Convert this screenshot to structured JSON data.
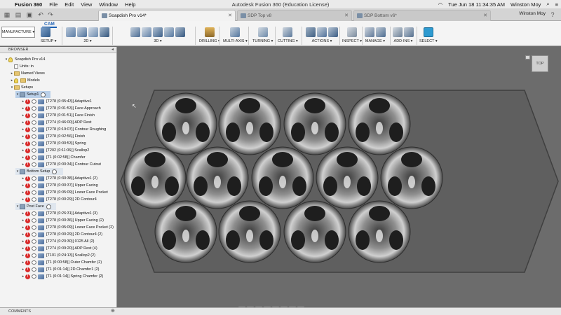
{
  "menubar": {
    "app_name": "Fusion 360",
    "menus": [
      "File",
      "Edit",
      "View",
      "Window",
      "Help"
    ],
    "window_title": "Autodesk Fusion 360 (Education License)",
    "datetime": "Tue Jun 18  11:34:35 AM",
    "user": "Winston Moy"
  },
  "tabs": [
    {
      "label": "Soapdish Pro v14*",
      "state": "active"
    },
    {
      "label": "SDP Top v8",
      "state": "inactive"
    },
    {
      "label": "SDP Bottom v6*",
      "state": "inactive"
    }
  ],
  "tabstrip_user": "Winston Moy",
  "toolbar": {
    "workspace": "MANUFACTURE",
    "cam_tab": "CAM",
    "groups": [
      {
        "label": "SETUP ▾"
      },
      {
        "label": "2D ▾"
      },
      {
        "label": "3D ▾"
      },
      {
        "label": "DRILLING ▾"
      },
      {
        "label": "MULTI-AXIS ▾"
      },
      {
        "label": "TURNING ▾"
      },
      {
        "label": "CUTTING ▾"
      },
      {
        "label": "ACTIONS ▾"
      },
      {
        "label": "INSPECT ▾"
      },
      {
        "label": "MANAGE ▾"
      },
      {
        "label": "ADD-INS ▾"
      },
      {
        "label": "SELECT ▾"
      }
    ]
  },
  "browser": {
    "header": "BROWSER",
    "root": "Soapdish Pro v14",
    "units": "Units: in",
    "named_views": "Named Views",
    "models": "Models",
    "setups": "Setups",
    "setup1": {
      "label": "Setup1",
      "ops": [
        "[T278 (0:35:43)] Adaptive1",
        "[T278 (0:01:53)] Face Approach",
        "[T278 (0:01:51)] Face Finish",
        "[T274 (0:46:00)] ADP Rest",
        "[T278 (0:19:07)] Contour Roughing",
        "[T278 (0:02:56)] Finish",
        "[T278 (0:00:53)] Spring",
        "[T202 (0:11:06)] Scallop2",
        "[T1 (0:02:58)] Chamfer",
        "[T278 (0:00:34)] Contour Cutout"
      ]
    },
    "bottom_setup": {
      "label": "Bottom Setup",
      "ops": [
        "[T278 (0:30:38)] Adaptive1 (2)",
        "[T278 (0:00:37)] Upper Facing",
        "[T278 (0:05:09)] Lower Face Pocket",
        "[T278 (0:00:29)] 2D Contour4"
      ]
    },
    "post_face": {
      "label": "Post Face",
      "ops": [
        "[T278 (0:26:31)] Adaptive1 (3)",
        "[T278 (0:00:36)] Upper Facing (2)",
        "[T278 (0:05:09)] Lower Face Pocket (2)",
        "[T278 (0:00:29)] 2D Contour4 (2)",
        "[T274 (0:20:30)] 0125 All (2)",
        "[T274 (0:09:20)] ADP Rest (4)",
        "[T101 (0:24:13)] Scallop2 (2)",
        "[T1 (0:00:58)] Outer Chamfer (2)",
        "[T1 (0:01:14)] 2D Chamfer1 (2)",
        "[T1 (0:01:14)] Spring Chamfer (2)"
      ]
    }
  },
  "comments": "COMMENTS",
  "viewcube_label": "TOP",
  "model": {
    "pocket_layout": "3 rows: 4, 5, 4",
    "plate_color": "#5f5f5f"
  }
}
